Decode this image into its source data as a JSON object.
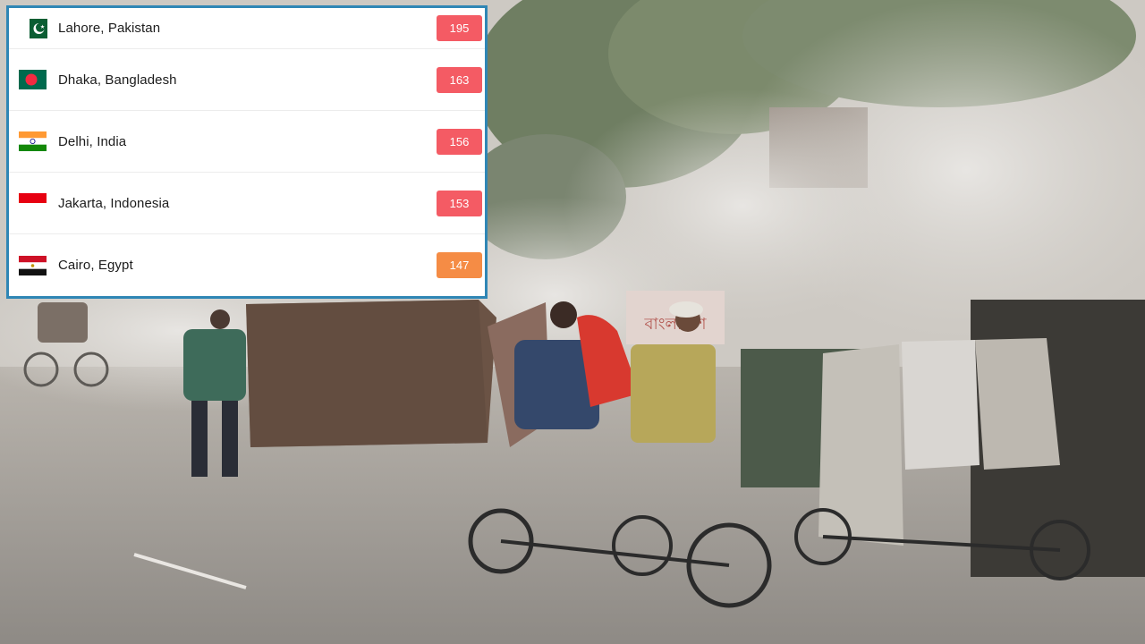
{
  "aqi_ranking": {
    "rows": [
      {
        "city": "Lahore, Pakistan",
        "aqi": "195",
        "flag": "pakistan-flag",
        "badge_color": "#f45b64"
      },
      {
        "city": "Dhaka, Bangladesh",
        "aqi": "163",
        "flag": "bangladesh-flag",
        "badge_color": "#f45b64"
      },
      {
        "city": "Delhi, India",
        "aqi": "156",
        "flag": "india-flag",
        "badge_color": "#f45b64"
      },
      {
        "city": "Jakarta, Indonesia",
        "aqi": "153",
        "flag": "indonesia-flag",
        "badge_color": "#f45b64"
      },
      {
        "city": "Cairo, Egypt",
        "aqi": "147",
        "flag": "egypt-flag",
        "badge_color": "#f58c45"
      }
    ]
  },
  "photo": {
    "sign_text": "বাংলাদেশ"
  },
  "colors": {
    "card_border": "#2f86b5",
    "unhealthy": "#f45b64",
    "unhealthy_sensitive": "#f58c45"
  }
}
